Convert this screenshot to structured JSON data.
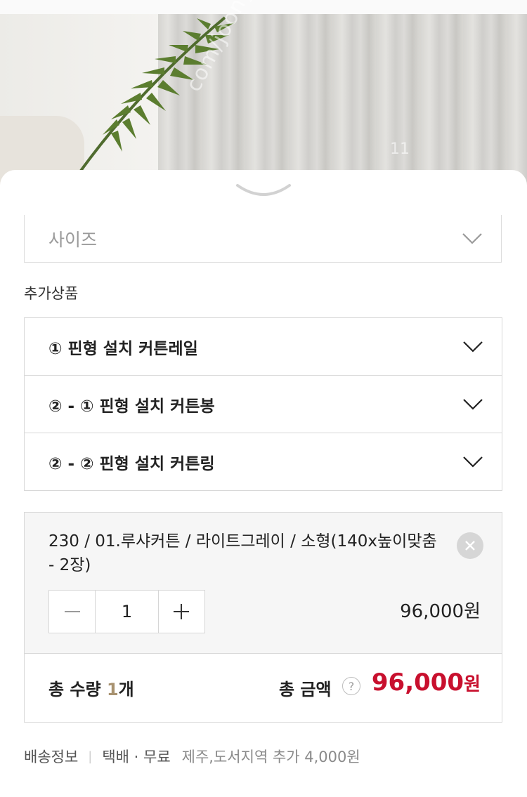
{
  "photo": {
    "watermark": "com/joonggonara",
    "watermark_num": "11"
  },
  "size_select": {
    "label": "사이즈"
  },
  "addons": {
    "title": "추가상품",
    "items": [
      {
        "label": "① 핀형 설치 커튼레일"
      },
      {
        "label": "② - ① 핀형 설치 커튼봉"
      },
      {
        "label": "② - ② 핀형 설치 커튼링"
      }
    ]
  },
  "selected_option": {
    "text": "230 / 01.루샤커튼 / 라이트그레이 / 소형(140x높이맞춤 - 2장)",
    "quantity": "1",
    "minus": "−",
    "plus": "+",
    "price": "96,000원"
  },
  "totals": {
    "qty_label": "총 수량",
    "qty_value": "1",
    "qty_unit": "개",
    "amount_label": "총 금액",
    "help": "?",
    "amount_value": "96,000",
    "amount_unit": "원"
  },
  "shipping": {
    "label": "배송정보",
    "method": "택배 · 무료",
    "extra": "제주,도서지역 추가 4,000원"
  },
  "colors": {
    "accent_price": "#c8102e",
    "qty_accent": "#a89270"
  }
}
